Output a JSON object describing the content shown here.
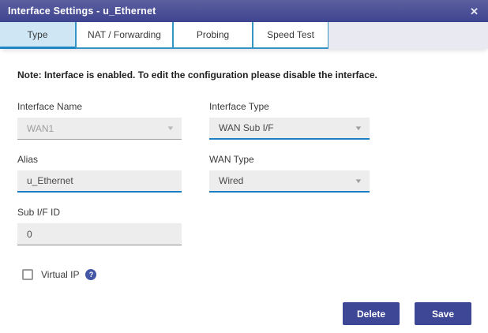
{
  "dialog": {
    "title": "Interface Settings - u_Ethernet",
    "close_glyph": "✕"
  },
  "tabs": [
    {
      "label": "Type",
      "active": true
    },
    {
      "label": "NAT / Forwarding",
      "active": false
    },
    {
      "label": "Probing",
      "active": false
    },
    {
      "label": "Speed Test",
      "active": false
    }
  ],
  "note": "Note: Interface is enabled. To edit the configuration please disable the interface.",
  "form": {
    "interface_name": {
      "label": "Interface Name",
      "value": "WAN1",
      "disabled": true
    },
    "interface_type": {
      "label": "Interface Type",
      "value": "WAN Sub I/F",
      "disabled": false
    },
    "alias": {
      "label": "Alias",
      "value": "u_Ethernet",
      "disabled": false
    },
    "wan_type": {
      "label": "WAN Type",
      "value": "Wired",
      "disabled": false
    },
    "sub_if_id": {
      "label": "Sub I/F ID",
      "value": "0",
      "disabled": false
    },
    "virtual_ip": {
      "label": "Virtual IP",
      "checked": false,
      "help_glyph": "?"
    }
  },
  "icons": {
    "dropdown_arrow": "▼"
  },
  "footer": {
    "delete_label": "Delete",
    "save_label": "Save"
  },
  "colors": {
    "titlebar_top": "#5c609f",
    "titlebar_bottom": "#3e4490",
    "tab_border": "#3795c5",
    "tab_active_bg": "#cfe7f4",
    "tab_active_underline": "#1e86c2",
    "field_bg": "#ededed",
    "field_underline_blue": "#1b7fc4",
    "button_bg": "#3d4795",
    "help_icon_bg": "#4456a6",
    "tabstrip_bg": "#e9e9f2"
  }
}
